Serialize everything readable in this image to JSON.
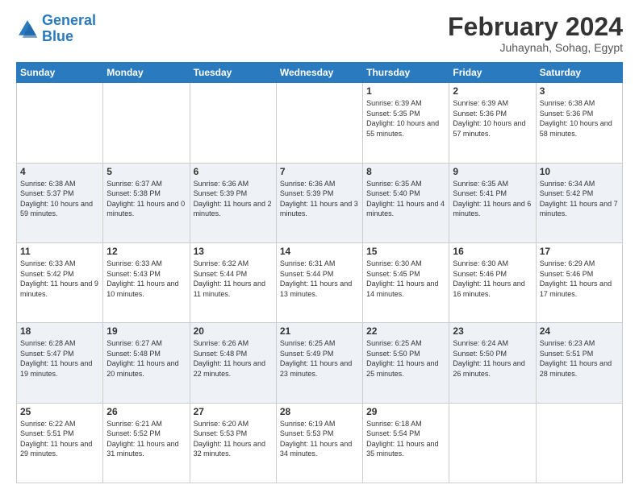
{
  "header": {
    "logo_line1": "General",
    "logo_line2": "Blue",
    "month_year": "February 2024",
    "location": "Juhaynah, Sohag, Egypt"
  },
  "weekdays": [
    "Sunday",
    "Monday",
    "Tuesday",
    "Wednesday",
    "Thursday",
    "Friday",
    "Saturday"
  ],
  "weeks": [
    [
      {
        "day": "",
        "info": ""
      },
      {
        "day": "",
        "info": ""
      },
      {
        "day": "",
        "info": ""
      },
      {
        "day": "",
        "info": ""
      },
      {
        "day": "1",
        "info": "Sunrise: 6:39 AM\nSunset: 5:35 PM\nDaylight: 10 hours and 55 minutes."
      },
      {
        "day": "2",
        "info": "Sunrise: 6:39 AM\nSunset: 5:36 PM\nDaylight: 10 hours and 57 minutes."
      },
      {
        "day": "3",
        "info": "Sunrise: 6:38 AM\nSunset: 5:36 PM\nDaylight: 10 hours and 58 minutes."
      }
    ],
    [
      {
        "day": "4",
        "info": "Sunrise: 6:38 AM\nSunset: 5:37 PM\nDaylight: 10 hours and 59 minutes."
      },
      {
        "day": "5",
        "info": "Sunrise: 6:37 AM\nSunset: 5:38 PM\nDaylight: 11 hours and 0 minutes."
      },
      {
        "day": "6",
        "info": "Sunrise: 6:36 AM\nSunset: 5:39 PM\nDaylight: 11 hours and 2 minutes."
      },
      {
        "day": "7",
        "info": "Sunrise: 6:36 AM\nSunset: 5:39 PM\nDaylight: 11 hours and 3 minutes."
      },
      {
        "day": "8",
        "info": "Sunrise: 6:35 AM\nSunset: 5:40 PM\nDaylight: 11 hours and 4 minutes."
      },
      {
        "day": "9",
        "info": "Sunrise: 6:35 AM\nSunset: 5:41 PM\nDaylight: 11 hours and 6 minutes."
      },
      {
        "day": "10",
        "info": "Sunrise: 6:34 AM\nSunset: 5:42 PM\nDaylight: 11 hours and 7 minutes."
      }
    ],
    [
      {
        "day": "11",
        "info": "Sunrise: 6:33 AM\nSunset: 5:42 PM\nDaylight: 11 hours and 9 minutes."
      },
      {
        "day": "12",
        "info": "Sunrise: 6:33 AM\nSunset: 5:43 PM\nDaylight: 11 hours and 10 minutes."
      },
      {
        "day": "13",
        "info": "Sunrise: 6:32 AM\nSunset: 5:44 PM\nDaylight: 11 hours and 11 minutes."
      },
      {
        "day": "14",
        "info": "Sunrise: 6:31 AM\nSunset: 5:44 PM\nDaylight: 11 hours and 13 minutes."
      },
      {
        "day": "15",
        "info": "Sunrise: 6:30 AM\nSunset: 5:45 PM\nDaylight: 11 hours and 14 minutes."
      },
      {
        "day": "16",
        "info": "Sunrise: 6:30 AM\nSunset: 5:46 PM\nDaylight: 11 hours and 16 minutes."
      },
      {
        "day": "17",
        "info": "Sunrise: 6:29 AM\nSunset: 5:46 PM\nDaylight: 11 hours and 17 minutes."
      }
    ],
    [
      {
        "day": "18",
        "info": "Sunrise: 6:28 AM\nSunset: 5:47 PM\nDaylight: 11 hours and 19 minutes."
      },
      {
        "day": "19",
        "info": "Sunrise: 6:27 AM\nSunset: 5:48 PM\nDaylight: 11 hours and 20 minutes."
      },
      {
        "day": "20",
        "info": "Sunrise: 6:26 AM\nSunset: 5:48 PM\nDaylight: 11 hours and 22 minutes."
      },
      {
        "day": "21",
        "info": "Sunrise: 6:25 AM\nSunset: 5:49 PM\nDaylight: 11 hours and 23 minutes."
      },
      {
        "day": "22",
        "info": "Sunrise: 6:25 AM\nSunset: 5:50 PM\nDaylight: 11 hours and 25 minutes."
      },
      {
        "day": "23",
        "info": "Sunrise: 6:24 AM\nSunset: 5:50 PM\nDaylight: 11 hours and 26 minutes."
      },
      {
        "day": "24",
        "info": "Sunrise: 6:23 AM\nSunset: 5:51 PM\nDaylight: 11 hours and 28 minutes."
      }
    ],
    [
      {
        "day": "25",
        "info": "Sunrise: 6:22 AM\nSunset: 5:51 PM\nDaylight: 11 hours and 29 minutes."
      },
      {
        "day": "26",
        "info": "Sunrise: 6:21 AM\nSunset: 5:52 PM\nDaylight: 11 hours and 31 minutes."
      },
      {
        "day": "27",
        "info": "Sunrise: 6:20 AM\nSunset: 5:53 PM\nDaylight: 11 hours and 32 minutes."
      },
      {
        "day": "28",
        "info": "Sunrise: 6:19 AM\nSunset: 5:53 PM\nDaylight: 11 hours and 34 minutes."
      },
      {
        "day": "29",
        "info": "Sunrise: 6:18 AM\nSunset: 5:54 PM\nDaylight: 11 hours and 35 minutes."
      },
      {
        "day": "",
        "info": ""
      },
      {
        "day": "",
        "info": ""
      }
    ]
  ]
}
